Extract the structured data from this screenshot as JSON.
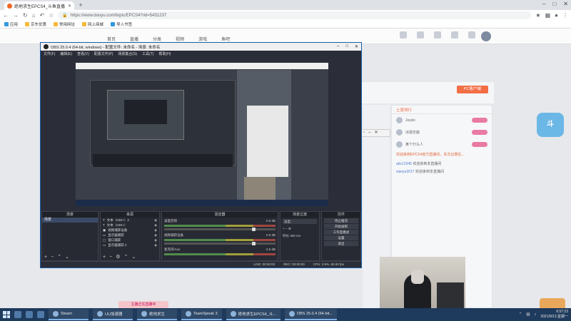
{
  "browser": {
    "tab_title": "绝地求生EPCS4_斗鱼直播",
    "url": "https://www.douyu.com/topic/EPCS4?rid=5431237",
    "bookmarks": [
      {
        "label": "应用",
        "icon": "apps-icon"
      },
      {
        "label": "京东优惠",
        "icon": "folder-icon"
      },
      {
        "label": "常用网址",
        "icon": "folder-icon"
      },
      {
        "label": "网上商城",
        "icon": "folder-icon"
      },
      {
        "label": "导入书签",
        "icon": "import-icon"
      }
    ]
  },
  "site": {
    "nav": [
      "首页",
      "直播",
      "分类",
      "视频",
      "游戏",
      "鱼吧"
    ],
    "pc_button": "PC客户端",
    "chat_header": "土豪排行",
    "chat_users": [
      "Joyslx",
      "冰狐无敌",
      "某个什么人"
    ],
    "chat_notice": "欢迎来到EPCS4官方直播间，本次比赛在...",
    "chat_messages": [
      {
        "user": "abc12345",
        "text": "欢迎来到本直播间"
      },
      {
        "user": "xiaoyu2017",
        "text": "欢迎来到本直播间"
      }
    ],
    "footer_banner": "主播正在直播中"
  },
  "obs": {
    "title": "OBS 25.0.4 (64-bit, windows) - 配置文件: 未命名 - 场景: 未命名",
    "menu": [
      "文件(F)",
      "编辑(E)",
      "查看(V)",
      "配置文件(P)",
      "场景集合(S)",
      "工具(T)",
      "帮助(H)"
    ],
    "docks": {
      "scenes": {
        "title": "场景",
        "items": [
          "场景"
        ]
      },
      "sources": {
        "title": "来源",
        "items": [
          "文本（GDI+）2",
          "文本（GDI+）",
          "视频捕获设备",
          "显示器捕获",
          "窗口捕获",
          "显示器捕获 2"
        ]
      },
      "mixer": {
        "title": "混音器",
        "channels": [
          {
            "name": "桌面音频",
            "db": "0.0 dB"
          },
          {
            "name": "视频捕获设备",
            "db": "0.0 dB"
          },
          {
            "name": "麦克风/Aux",
            "db": "-2.5 dB"
          }
        ]
      },
      "transitions": {
        "title": "场景过渡",
        "type": "淡出",
        "duration_label": "时长",
        "duration_value": "300 ms"
      },
      "controls": {
        "title": "控件",
        "buttons": [
          "停止推流",
          "开始录制",
          "工作室模式",
          "设置",
          "退出"
        ]
      }
    },
    "status": {
      "live": "LIVE: 00:00:00",
      "rec": "REC: 00:00:00",
      "cpu": "CPU: 3.9%, 60.00 fps"
    }
  },
  "taskbar": {
    "items": [
      "Steam",
      "UU加速器",
      "绝地求生",
      "TeamSpeak 3",
      "绝地求生EPCS4_斗...",
      "OBS 25.0.4 (64-bit..."
    ],
    "time": "6:57:23",
    "date": "2021/9/13 星期一"
  }
}
